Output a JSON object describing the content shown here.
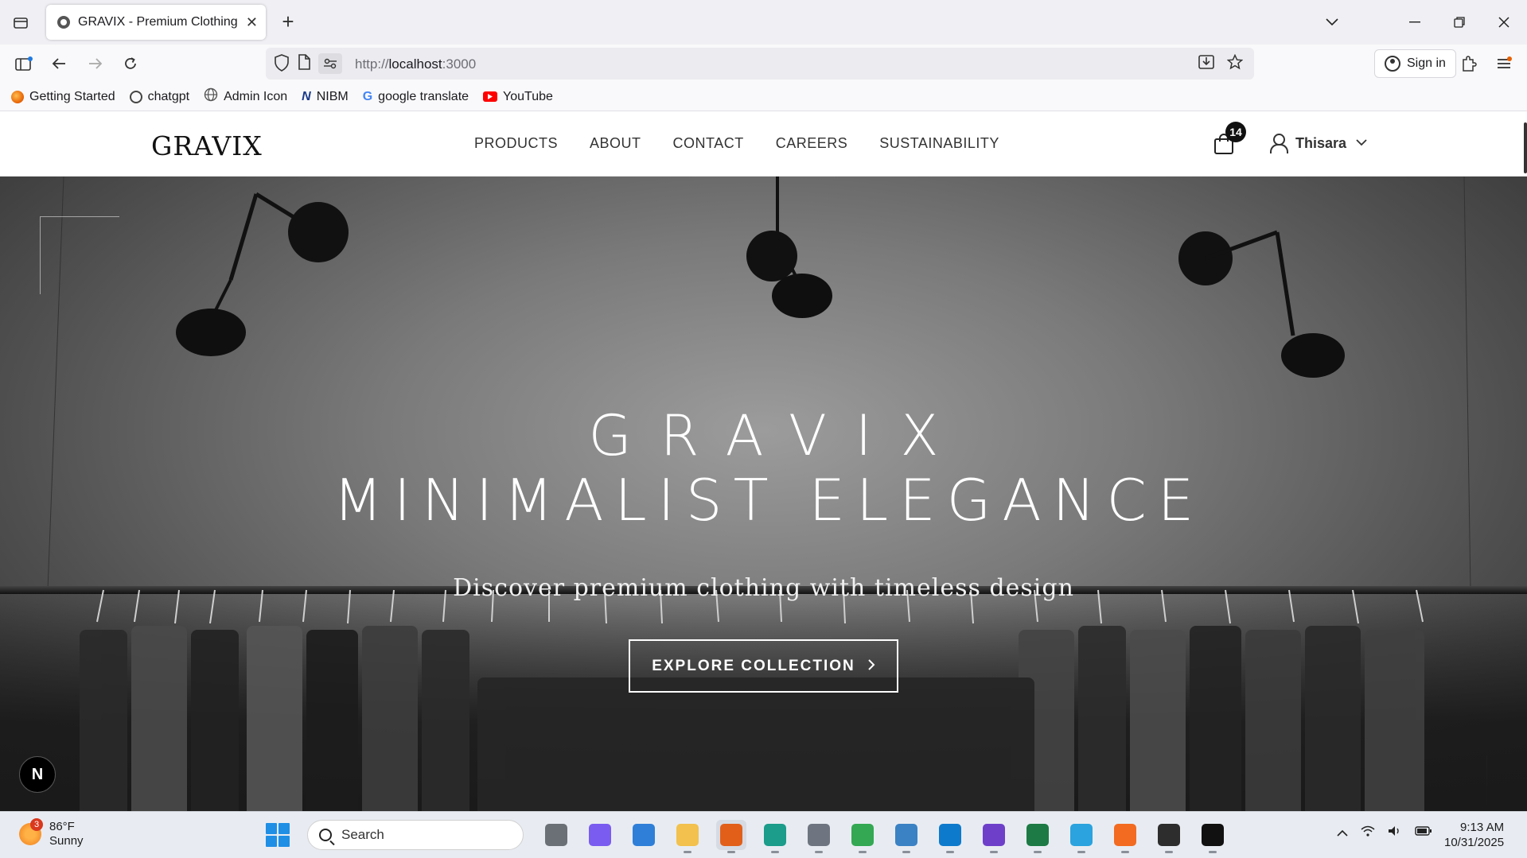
{
  "browser": {
    "tab_title": "GRAVIX - Premium Clothing Sto",
    "url_scheme": "http://",
    "url_host": "localhost",
    "url_port": ":3000",
    "sign_in_label": "Sign in",
    "bookmarks": [
      {
        "label": "Getting Started",
        "icon": "firefox-icon",
        "color": "#e66000"
      },
      {
        "label": "chatgpt",
        "icon": "chatgpt-icon",
        "color": "#444444"
      },
      {
        "label": "Admin Icon",
        "icon": "globe-icon",
        "color": "#555555"
      },
      {
        "label": "NIBM",
        "icon": "nibm-icon",
        "color": "#1a3a8a"
      },
      {
        "label": "google translate",
        "icon": "google-icon",
        "color": "#4285f4"
      },
      {
        "label": "YouTube",
        "icon": "youtube-icon",
        "color": "#ff0000"
      }
    ]
  },
  "site": {
    "logo": "GRAVIX",
    "nav": [
      "PRODUCTS",
      "ABOUT",
      "CONTACT",
      "CAREERS",
      "SUSTAINABILITY"
    ],
    "cart_count": "14",
    "user_name": "Thisara"
  },
  "hero": {
    "title": "GRAVIX",
    "subtitle": "MINIMALIST ELEGANCE",
    "tagline": "Discover premium clothing with timeless design",
    "cta": "EXPLORE COLLECTION",
    "next_badge": "N"
  },
  "taskbar": {
    "temperature": "86°F",
    "condition": "Sunny",
    "weather_badge": "3",
    "search_placeholder": "Search",
    "time": "9:13 AM",
    "date": "10/31/2025",
    "apps": [
      {
        "name": "task-view",
        "color": "#6b6f76"
      },
      {
        "name": "copilot",
        "color": "#7a5cf0"
      },
      {
        "name": "microsoft-store",
        "color": "#2f7fd8"
      },
      {
        "name": "file-explorer",
        "color": "#f2c14e"
      },
      {
        "name": "firefox",
        "color": "#e25f1a"
      },
      {
        "name": "edge",
        "color": "#1c9c8b"
      },
      {
        "name": "settings",
        "color": "#6e7580"
      },
      {
        "name": "chrome",
        "color": "#34a853"
      },
      {
        "name": "photos",
        "color": "#3b82c4"
      },
      {
        "name": "vscode",
        "color": "#0e7acc"
      },
      {
        "name": "github-desktop",
        "color": "#6e40c9"
      },
      {
        "name": "excel-app",
        "color": "#1d7a44"
      },
      {
        "name": "telegram",
        "color": "#2aa3de"
      },
      {
        "name": "xampp",
        "color": "#f26b21"
      },
      {
        "name": "terminal",
        "color": "#2d2d2d"
      },
      {
        "name": "capcut",
        "color": "#111111"
      }
    ]
  }
}
